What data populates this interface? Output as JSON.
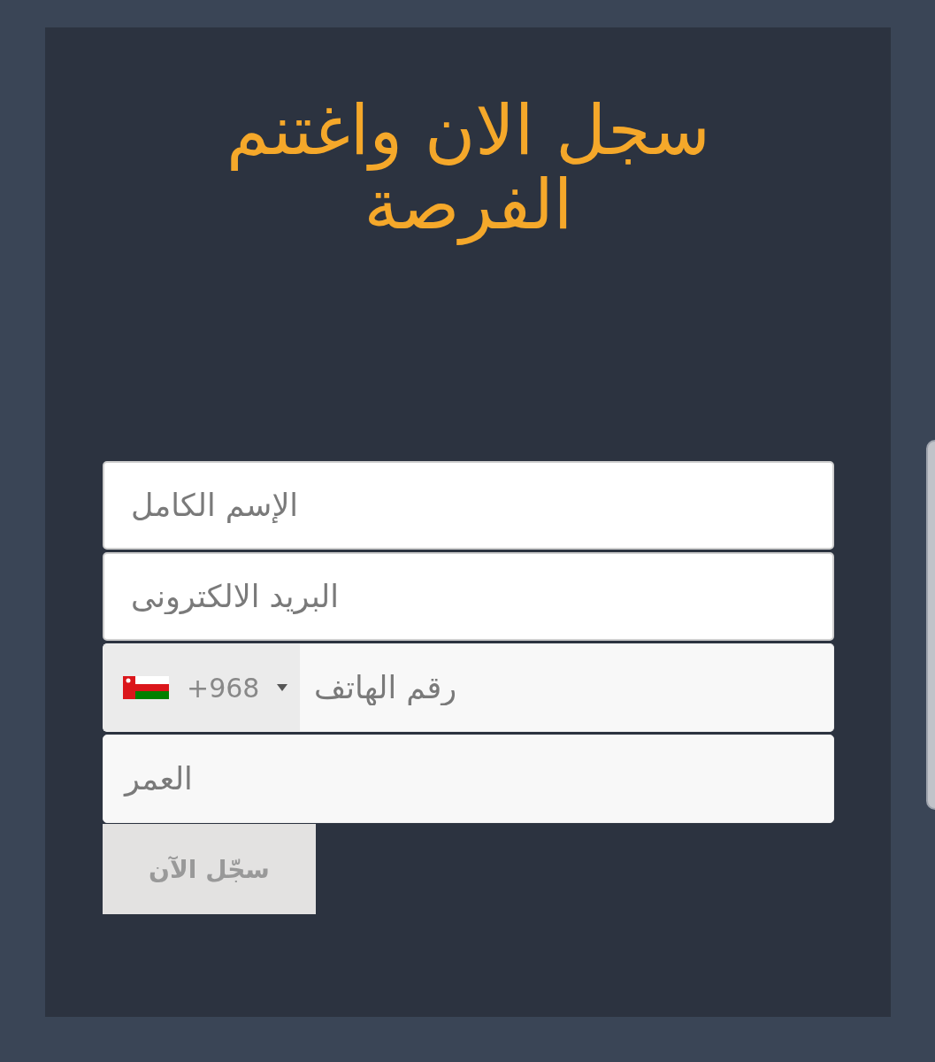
{
  "title": "سجل الان واغتنم الفرصة",
  "form": {
    "fields": [
      {
        "kind": "text",
        "placeholder": "الإسم الكامل"
      },
      {
        "kind": "text",
        "placeholder": "البريد الالكترونى"
      },
      {
        "kind": "phone",
        "country_code": "+968",
        "placeholder": "رقم الهاتف"
      },
      {
        "kind": "number",
        "placeholder": "العمر"
      }
    ],
    "submit": "سجّل الآن"
  }
}
